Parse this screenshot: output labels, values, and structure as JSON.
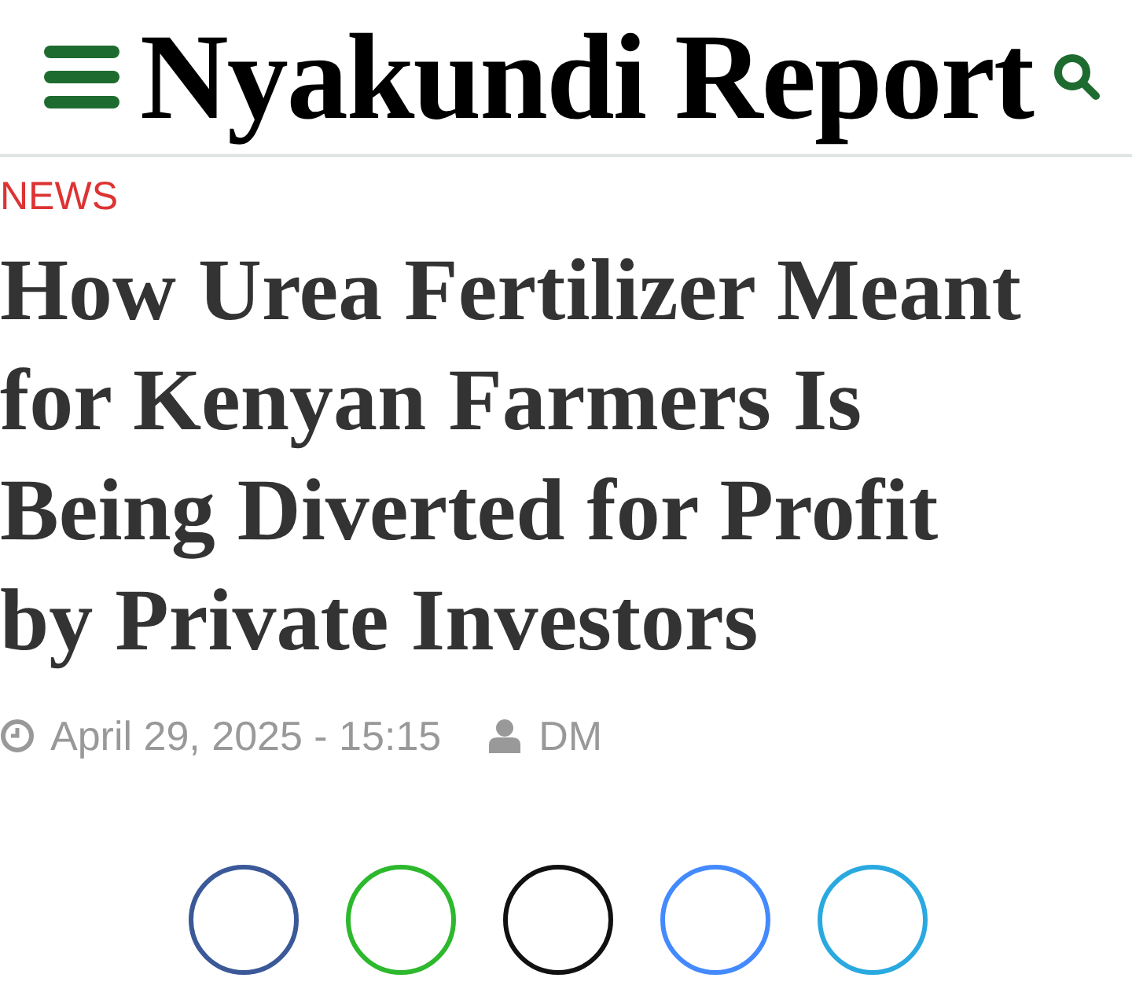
{
  "header": {
    "logo": "Nyakundi Report"
  },
  "article": {
    "category": "NEWS",
    "title": "How Urea Fertilizer Meant for Kenyan Farmers Is Being Diverted for Profit by Private Investors",
    "date": "April 29, 2025 - 15:15",
    "author": "DM"
  },
  "share_buttons": [
    {
      "color": "#3b5998"
    },
    {
      "color": "#2db82d"
    },
    {
      "color": "#111111"
    },
    {
      "color": "#448aff"
    },
    {
      "color": "#29a9e0"
    }
  ]
}
